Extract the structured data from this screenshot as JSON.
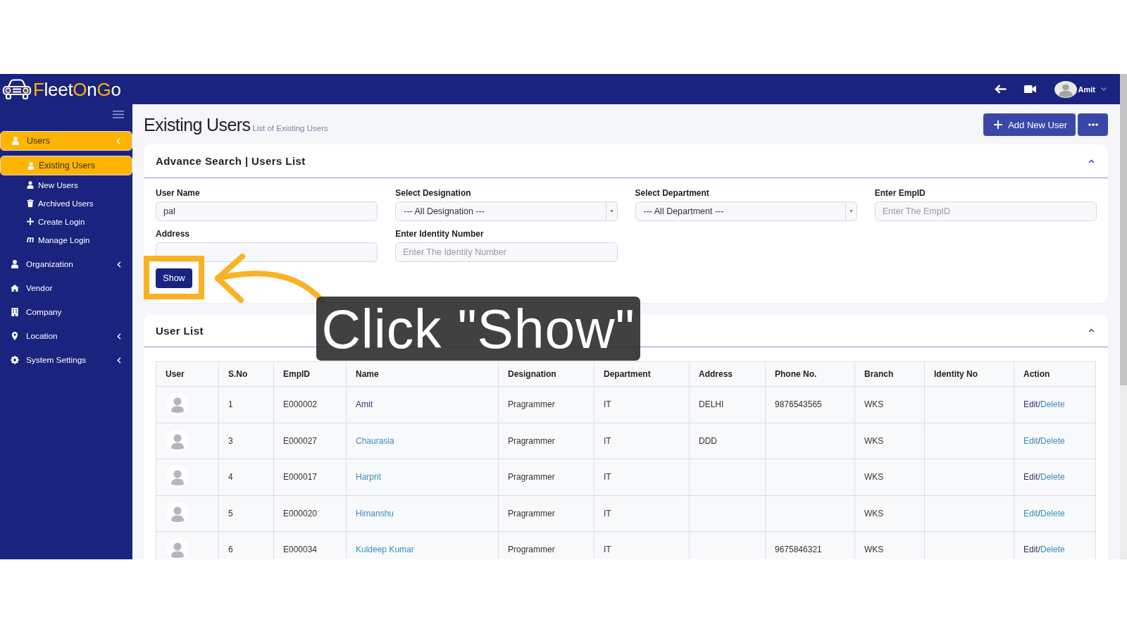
{
  "header": {
    "logo": [
      {
        "text": "F",
        "accent": true
      },
      {
        "text": "leet",
        "accent": false
      },
      {
        "text": "O",
        "accent": true
      },
      {
        "text": "n",
        "accent": false
      },
      {
        "text": "G",
        "accent": true
      },
      {
        "text": "o",
        "accent": false
      }
    ],
    "user_name": "Amit"
  },
  "sidebar": {
    "items": [
      {
        "label": "Users",
        "kind": "users",
        "selected": true,
        "has_submenu": true,
        "children": [
          {
            "label": "Existing Users",
            "kind": "users",
            "selected": true
          },
          {
            "label": "New Users",
            "kind": "users",
            "selected": false
          },
          {
            "label": "Archived Users",
            "kind": "archive",
            "selected": false
          },
          {
            "label": "Create Login",
            "kind": "create",
            "selected": false
          },
          {
            "label": "Manage Login",
            "kind": "manage",
            "glyph": "m",
            "selected": false
          }
        ]
      },
      {
        "label": "Organization",
        "kind": "organization",
        "selected": false,
        "has_submenu": true
      },
      {
        "label": "Vendor",
        "kind": "vendor",
        "selected": false,
        "has_submenu": false
      },
      {
        "label": "Company",
        "kind": "company",
        "selected": false,
        "has_submenu": false
      },
      {
        "label": "Location",
        "kind": "location",
        "selected": false,
        "has_submenu": true
      },
      {
        "label": "System Settings",
        "kind": "settings",
        "selected": false,
        "has_submenu": true
      }
    ]
  },
  "page": {
    "title": "Existing Users",
    "subtitle": "List of Existing Users",
    "add_button": "Add New User"
  },
  "search": {
    "title": "Advance Search | Users List",
    "fields": [
      {
        "kind": "text",
        "label": "User Name",
        "value": "pal"
      },
      {
        "kind": "select",
        "label": "Select Designation",
        "value": "--- All Designation ---"
      },
      {
        "kind": "select",
        "label": "Select Department",
        "value": "--- All Department ---"
      },
      {
        "kind": "text",
        "label": "Enter EmpID",
        "placeholder": "Enter The EmpID"
      },
      {
        "kind": "text",
        "label": "Address"
      },
      {
        "kind": "text",
        "label": "Enter Identity Number",
        "placeholder": "Enter The Identity Number"
      }
    ],
    "button": "Show"
  },
  "user_list": {
    "title": "User List",
    "columns": [
      "User",
      "S.No",
      "EmpID",
      "Name",
      "Designation",
      "Department",
      "Address",
      "Phone No.",
      "Branch",
      "Identity No",
      "Action"
    ],
    "rows": [
      {
        "sno": "1",
        "emp_id": "E000002",
        "name": {
          "text": "Amit",
          "visited": true
        },
        "designation": "Pragrammer",
        "department": "IT",
        "address": "DELHI",
        "phone": "9876543565",
        "branch": "WKS",
        "action": {
          "edit": {
            "text": "Edit",
            "visited": true
          },
          "separator": "/",
          "delete": {
            "text": "Delete",
            "visited": false
          }
        }
      },
      {
        "sno": "3",
        "emp_id": "E000027",
        "name": {
          "text": "Chaurasia",
          "visited": false
        },
        "designation": "Pragrammer",
        "department": "IT",
        "address": "DDD",
        "branch": "WKS",
        "action": {
          "edit": {
            "text": "Edit",
            "visited": false
          },
          "separator": "/",
          "delete": {
            "text": "Delete",
            "visited": false
          }
        }
      },
      {
        "sno": "4",
        "emp_id": "E000017",
        "name": {
          "text": "Harprit",
          "visited": false
        },
        "designation": "Pragrammer",
        "department": "IT",
        "branch": "WKS",
        "action": {
          "edit": {
            "text": "Edit",
            "visited": true
          },
          "separator": "/",
          "delete": {
            "text": "Delete",
            "visited": false
          }
        }
      },
      {
        "sno": "5",
        "emp_id": "E000020",
        "name": {
          "text": "Himanshu",
          "visited": false
        },
        "designation": "Pragrammer",
        "department": "IT",
        "branch": "WKS",
        "action": {
          "edit": {
            "text": "Edit",
            "visited": false
          },
          "separator": "/",
          "delete": {
            "text": "Delete",
            "visited": false
          }
        }
      },
      {
        "sno": "6",
        "emp_id": "E000034",
        "name": {
          "text": "Kuldeep Kumar",
          "visited": false
        },
        "designation": "Programmer",
        "department": "IT",
        "phone": "9675846321",
        "branch": "WKS",
        "action": {
          "edit": {
            "text": "Edit",
            "visited": true
          },
          "separator": "/",
          "delete": {
            "text": "Delete",
            "visited": false
          }
        }
      }
    ]
  },
  "annotation": {
    "caption": "Click \"Show\""
  }
}
